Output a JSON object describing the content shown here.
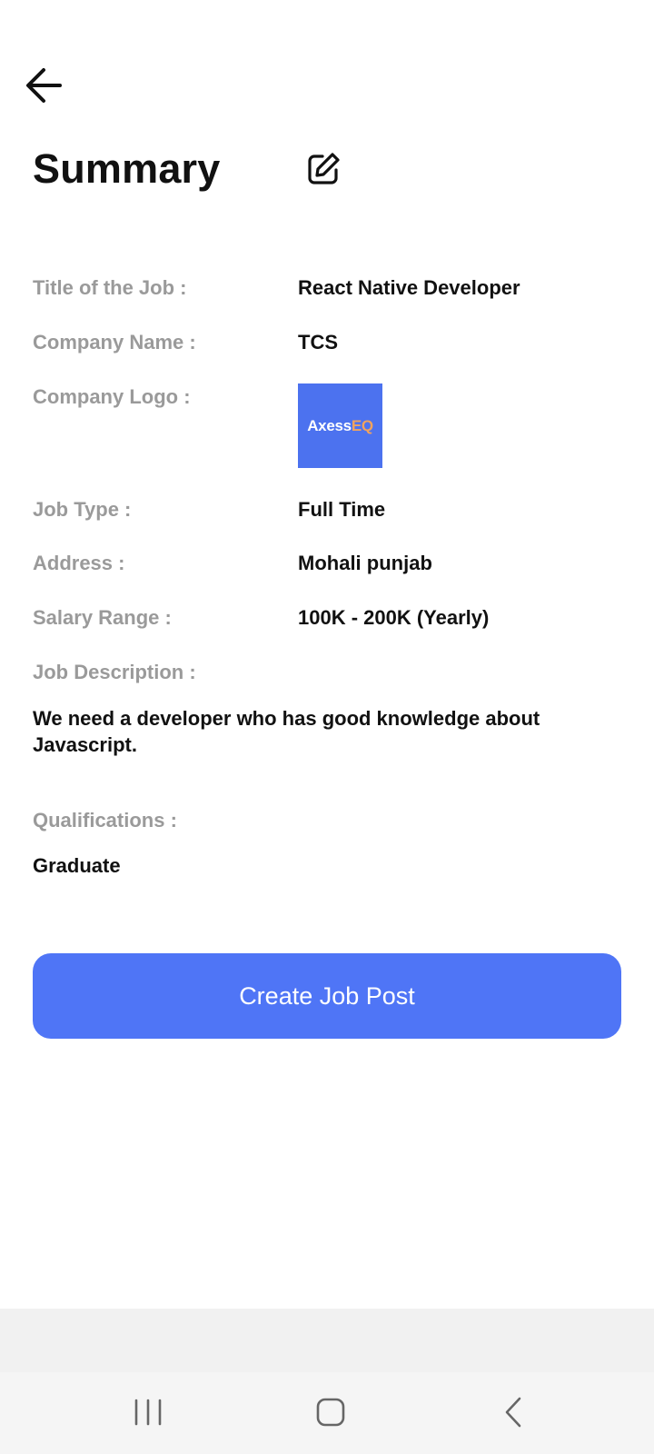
{
  "header": {
    "title": "Summary"
  },
  "fields": {
    "job_title": {
      "label": "Title of the Job :",
      "value": "React Native Developer"
    },
    "company_name": {
      "label": "Company Name :",
      "value": "TCS"
    },
    "company_logo": {
      "label": "Company Logo :",
      "logo_text_part1": "Axess",
      "logo_text_part2": "EQ"
    },
    "job_type": {
      "label": "Job Type :",
      "value": "Full Time"
    },
    "address": {
      "label": "Address :",
      "value": "Mohali punjab"
    },
    "salary_range": {
      "label": "Salary Range :",
      "value": "100K - 200K (Yearly)"
    },
    "job_description": {
      "label": "Job Description :",
      "value": "We need a developer who has good knowledge about Javascript."
    },
    "qualifications": {
      "label": "Qualifications :",
      "value": "Graduate"
    }
  },
  "actions": {
    "create_label": "Create Job Post"
  },
  "icons": {
    "back": "arrow-left-icon",
    "edit": "edit-icon",
    "nav_recents": "recents-icon",
    "nav_home": "home-icon",
    "nav_back": "chevron-left-icon"
  },
  "colors": {
    "accent": "#4f75f6",
    "logo_bg": "#4c72ef",
    "label_gray": "#9a9a9a"
  }
}
